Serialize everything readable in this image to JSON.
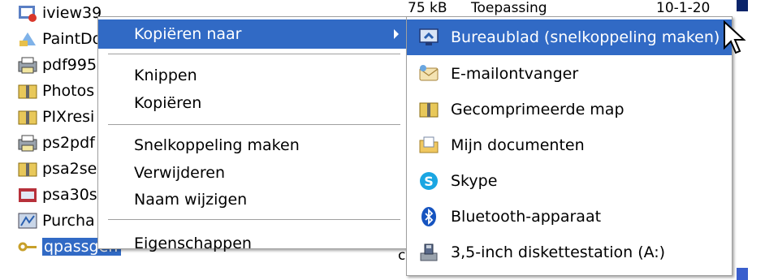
{
  "files": [
    {
      "name": "iview39",
      "icon": "application-icon"
    },
    {
      "name": "PaintDo",
      "icon": "paint-icon"
    },
    {
      "name": "pdf995",
      "icon": "printer-icon"
    },
    {
      "name": "Photos",
      "icon": "zip-folder-icon"
    },
    {
      "name": "PIXresi",
      "icon": "zip-folder-icon"
    },
    {
      "name": "ps2pdf",
      "icon": "printer-icon"
    },
    {
      "name": "psa2se",
      "icon": "zip-folder-icon"
    },
    {
      "name": "psa30s",
      "icon": "installer-icon"
    },
    {
      "name": "Purcha",
      "icon": "setup-icon"
    },
    {
      "name": "qpassgen",
      "icon": "key-icon",
      "selected": true
    }
  ],
  "background_details": {
    "size": "75 kB",
    "type": "Toepassing",
    "date": "10-1-20",
    "row_fragment": "c"
  },
  "context_menu": {
    "items": [
      {
        "label": "Kopiëren naar",
        "highlighted": true,
        "has_submenu": true
      },
      {
        "label": "Knippen"
      },
      {
        "label": "Kopiëren"
      },
      {
        "label": "Snelkoppeling maken"
      },
      {
        "label": "Verwijderen"
      },
      {
        "label": "Naam wijzigen"
      },
      {
        "label": "Eigenschappen"
      }
    ]
  },
  "submenu": {
    "items": [
      {
        "label": "Bureaublad (snelkoppeling maken)",
        "icon": "desktop-icon",
        "highlighted": true
      },
      {
        "label": "E-mailontvanger",
        "icon": "mail-icon"
      },
      {
        "label": "Gecomprimeerde map",
        "icon": "zip-folder-icon"
      },
      {
        "label": "Mijn documenten",
        "icon": "documents-folder-icon"
      },
      {
        "label": "Skype",
        "icon": "skype-icon"
      },
      {
        "label": "Bluetooth-apparaat",
        "icon": "bluetooth-icon"
      },
      {
        "label": "3,5-inch diskettestation (A:)",
        "icon": "floppy-drive-icon"
      }
    ]
  },
  "colors": {
    "highlight": "#316ac5",
    "menu_border": "#a0a0a0"
  }
}
